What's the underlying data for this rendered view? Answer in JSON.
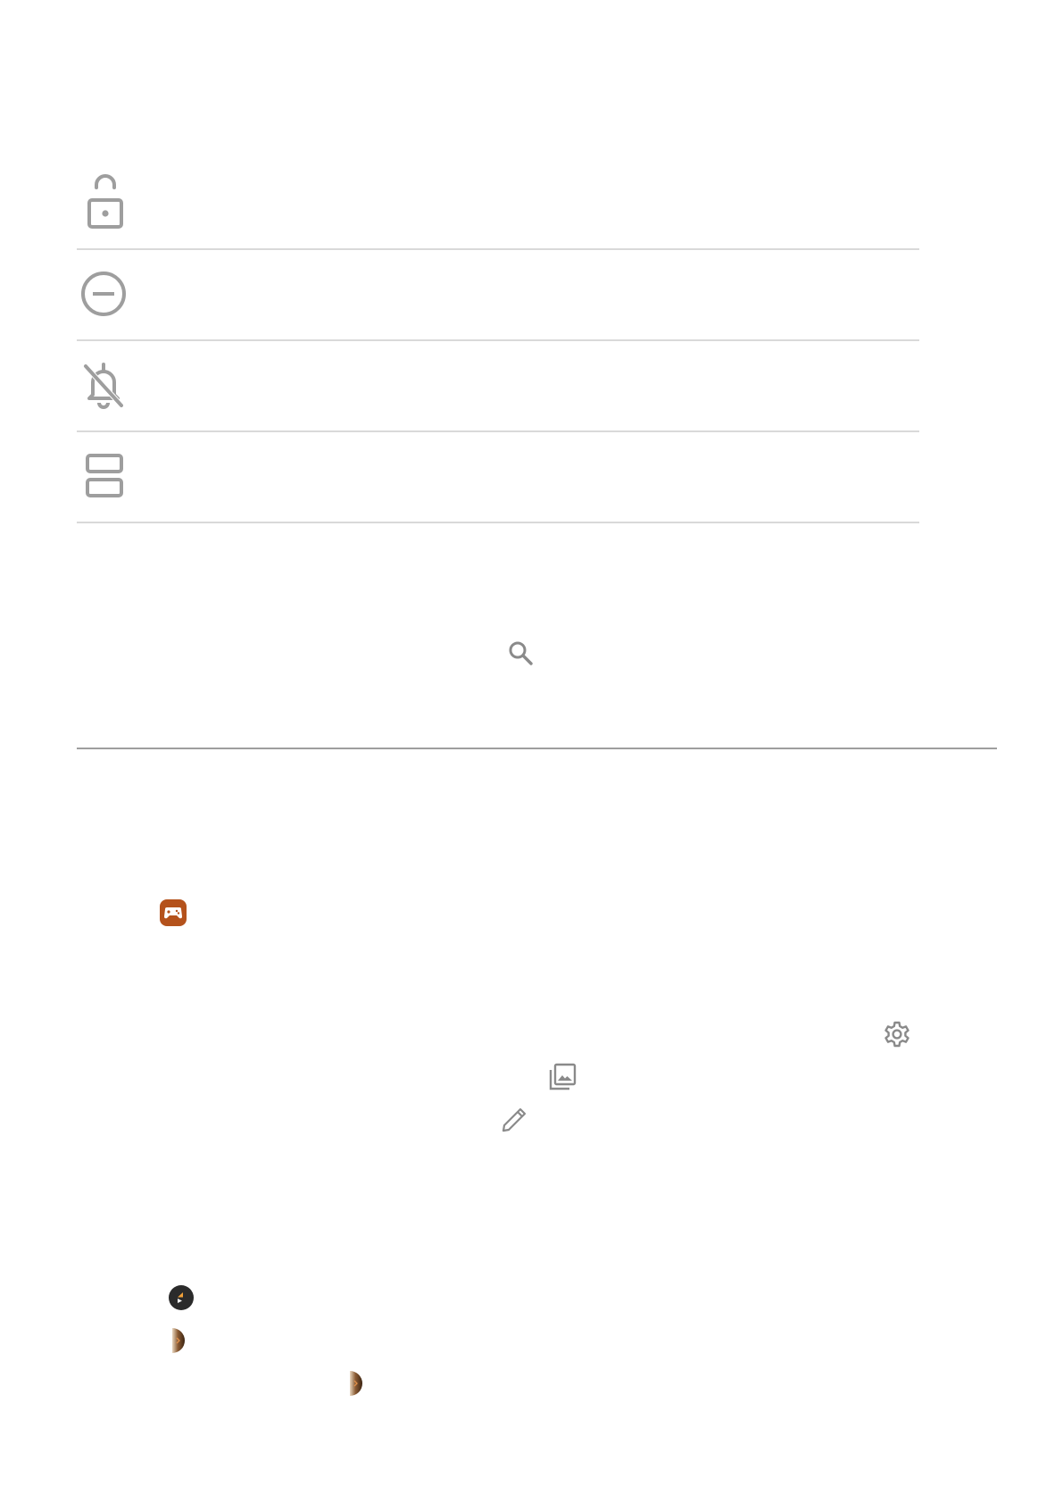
{
  "icons": {
    "settings_rows": [
      "unlock-icon",
      "do-not-disturb-icon",
      "notifications-off-icon",
      "split-screen-icon"
    ],
    "inline": [
      "search-icon",
      "game-controller-app-icon",
      "settings-gear-icon",
      "photo-gallery-icon",
      "edit-pencil-icon",
      "media-play-badge-icon",
      "half-thumbnail-icon",
      "half-thumbnail-icon"
    ]
  },
  "colors": {
    "icon_gray": "#9e9e9e",
    "divider": "#d9d9d9",
    "app_orange": "#b4521c",
    "badge_dark": "#2b2b2b"
  }
}
